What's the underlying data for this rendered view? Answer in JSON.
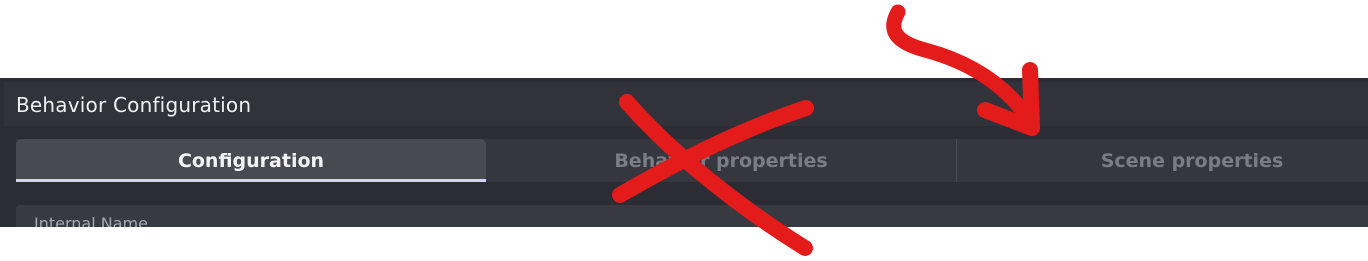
{
  "window": {
    "title": "Behavior Configuration"
  },
  "tabs": [
    {
      "label": "Configuration",
      "active": true
    },
    {
      "label": "Behavior properties",
      "active": false
    },
    {
      "label": "Scene properties",
      "active": false
    }
  ],
  "form": {
    "field_label": "Internal Name"
  },
  "annotations": {
    "color": "#e41b1b",
    "items": [
      "cross-mark",
      "arrow-pointer"
    ]
  },
  "theme": {
    "panel_bg": "#2c2c34",
    "active_tab_bg": "#494952",
    "active_tab_underline": "#d4cffc"
  }
}
